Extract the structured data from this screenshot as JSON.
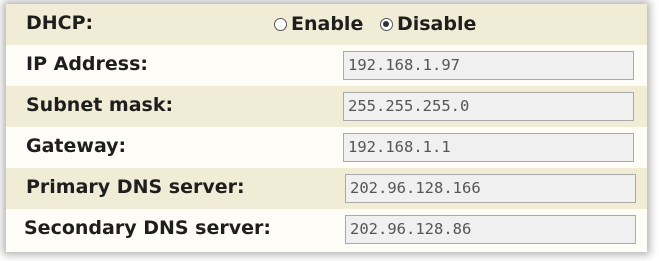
{
  "dhcp": {
    "label": "DHCP:",
    "options": [
      {
        "label": "Enable",
        "checked": false
      },
      {
        "label": "Disable",
        "checked": true
      }
    ]
  },
  "fields": [
    {
      "label": "IP Address:",
      "value": "192.168.1.97"
    },
    {
      "label": "Subnet mask:",
      "value": "255.255.255.0"
    },
    {
      "label": "Gateway:",
      "value": "192.168.1.1"
    },
    {
      "label": "Primary DNS server:",
      "value": "202.96.128.166"
    },
    {
      "label": "Secondary DNS server:",
      "value": "202.96.128.86"
    }
  ],
  "colors": {
    "band": "#f1ecd6",
    "plain": "#fdfcf7",
    "field_bg": "#f0f0f0",
    "field_border": "#a9a9a9",
    "label_text": "#1e1e1e",
    "field_text": "#555555"
  }
}
